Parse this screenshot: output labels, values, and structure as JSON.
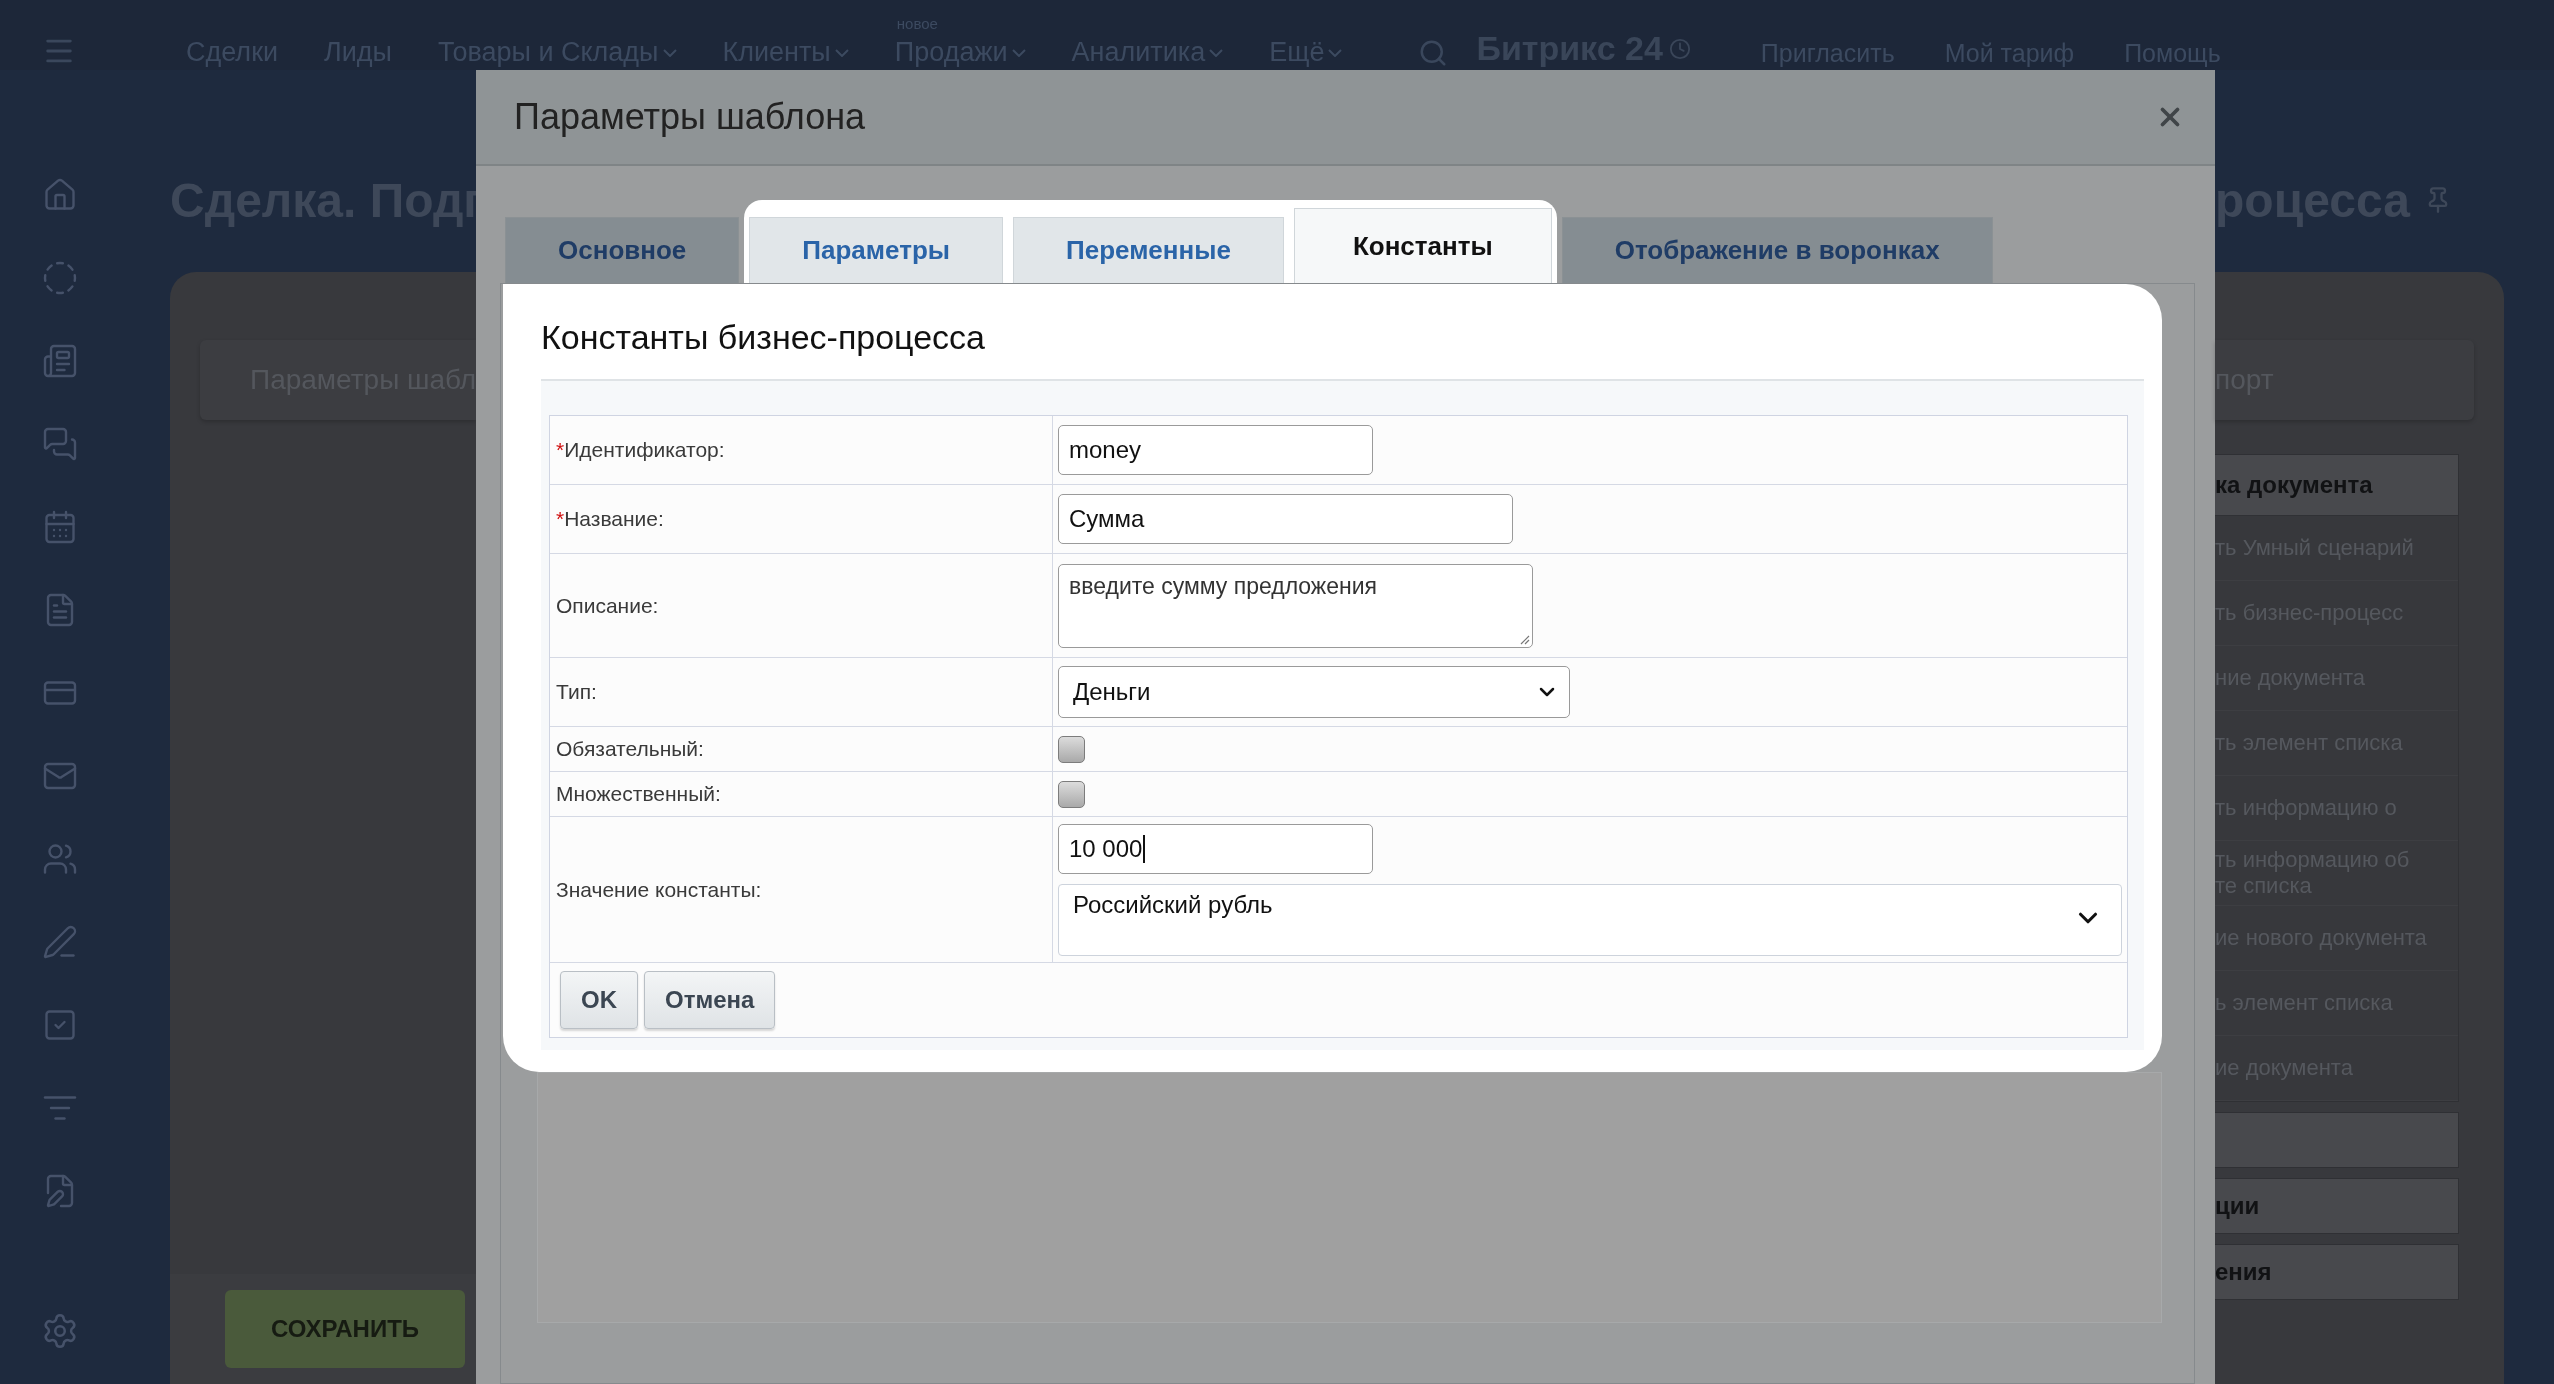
{
  "top_nav": {
    "items": [
      {
        "label": "Сделки",
        "has_menu": false
      },
      {
        "label": "Лиды",
        "has_menu": false
      },
      {
        "label": "Товары и Склады",
        "has_menu": true
      },
      {
        "label": "Клиенты",
        "has_menu": true
      },
      {
        "label": "Продажи",
        "has_menu": true,
        "badge": "новое"
      },
      {
        "label": "Аналитика",
        "has_menu": true
      },
      {
        "label": "Ещё",
        "has_menu": true
      }
    ],
    "logo": "Битрикс 24",
    "links": [
      "Пригласить",
      "Мой тариф",
      "Помощь"
    ]
  },
  "background_left": {
    "page_title": "Сделка. Подг",
    "tab_label": "Параметры шабл",
    "save_button": "СОХРАНИТЬ"
  },
  "background_right": {
    "page_title": "роцесса",
    "tab_label": "порт",
    "panel_header": "ка документа",
    "items": [
      "ть Умный сценарий",
      "ть бизнес-процесс",
      "ние документа",
      "ть элемент списка",
      "ть информацию о",
      "ть информацию об\nте списка",
      "ие нового документа",
      "ь элемент списка",
      "ие документа"
    ],
    "sections": [
      "ции",
      "ения"
    ]
  },
  "dialog": {
    "title": "Параметры шаблона",
    "tabs": [
      {
        "label": "Основное",
        "selected": false,
        "highlighted": false
      },
      {
        "label": "Параметры",
        "selected": false,
        "highlighted": true
      },
      {
        "label": "Переменные",
        "selected": false,
        "highlighted": true
      },
      {
        "label": "Константы",
        "selected": true,
        "highlighted": true
      },
      {
        "label": "Отображение в воронках",
        "selected": false,
        "highlighted": false
      }
    ],
    "section_title": "Константы бизнес-процесса",
    "fields": [
      {
        "kind": "text",
        "label": "Идентификатор:",
        "required_mark": "*",
        "value": "money"
      },
      {
        "kind": "text",
        "label": "Название:",
        "required_mark": "*",
        "value": "Сумма"
      },
      {
        "kind": "textarea",
        "label": "Описание:",
        "value": "введите сумму предложения"
      },
      {
        "kind": "select",
        "label": "Тип:",
        "value": "Деньги"
      },
      {
        "kind": "checkbox",
        "label": "Обязательный:",
        "checked": false
      },
      {
        "kind": "checkbox",
        "label": "Множественный:",
        "checked": false
      },
      {
        "kind": "money",
        "label": "Значение константы:",
        "value": "10 000",
        "focused": true,
        "currency": "Российский рубль"
      }
    ],
    "buttons": [
      "OK",
      "Отмена"
    ]
  }
}
